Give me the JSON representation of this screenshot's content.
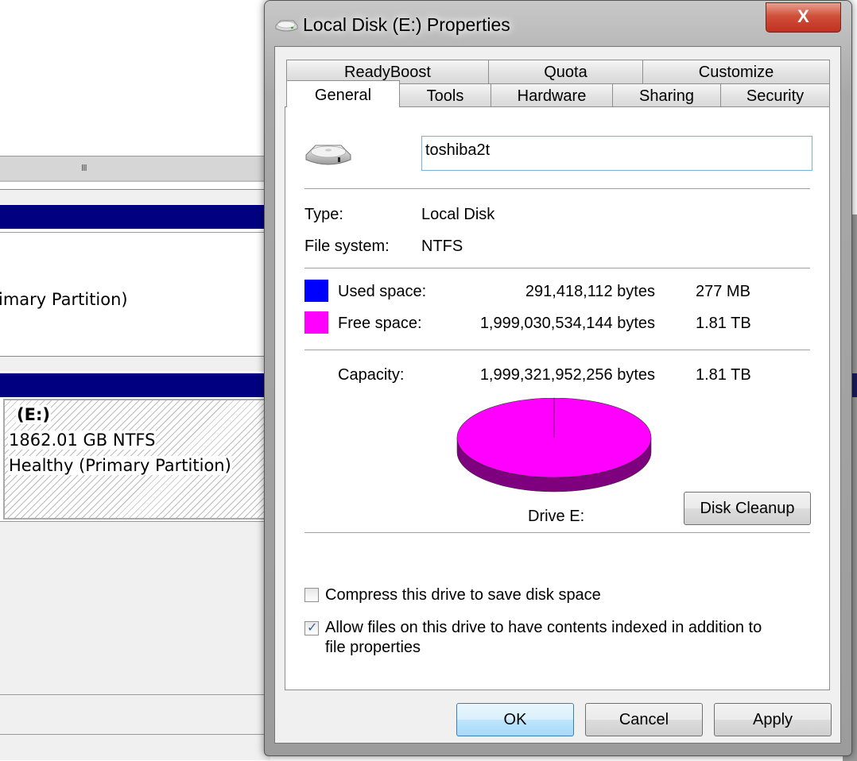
{
  "background": {
    "partition1_status_fragment": "imary Partition)",
    "partition2": {
      "drive_letter": "(E:)",
      "size_fs": "1862.01 GB NTFS",
      "status": "Healthy (Primary Partition)"
    },
    "scroll_grip": "III"
  },
  "dialog": {
    "title": "Local Disk (E:) Properties",
    "close_label": "X",
    "tabs_back_row": [
      {
        "label": "ReadyBoost"
      },
      {
        "label": "Quota"
      },
      {
        "label": "Customize"
      }
    ],
    "tabs_front_row": [
      {
        "label": "General",
        "active": true
      },
      {
        "label": "Tools"
      },
      {
        "label": "Hardware"
      },
      {
        "label": "Sharing"
      },
      {
        "label": "Security"
      }
    ],
    "general": {
      "volume_name": "toshiba2t",
      "type_label": "Type:",
      "type_value": "Local Disk",
      "fs_label": "File system:",
      "fs_value": "NTFS",
      "used": {
        "label": "Used space:",
        "bytes": "291,418,112 bytes",
        "size": "277 MB",
        "color": "#0000ff"
      },
      "free": {
        "label": "Free space:",
        "bytes": "1,999,030,534,144 bytes",
        "size": "1.81 TB",
        "color": "#ff00ff"
      },
      "capacity": {
        "label": "Capacity:",
        "bytes": "1,999,321,952,256 bytes",
        "size": "1.81 TB"
      },
      "drive_label": "Drive E:",
      "disk_cleanup_label": "Disk Cleanup",
      "compress": {
        "label": "Compress this drive to save disk space",
        "checked": false
      },
      "index": {
        "label_line1": "Allow files on this drive to have contents indexed in addition to",
        "label_line2": "file properties",
        "checked": true
      },
      "check_mark": "✓"
    },
    "buttons": {
      "ok": "OK",
      "cancel": "Cancel",
      "apply": "Apply"
    }
  },
  "chart_data": {
    "type": "pie",
    "title": "Drive E:",
    "categories": [
      "Used space",
      "Free space"
    ],
    "values": [
      291418112,
      1999030534144
    ],
    "colors": [
      "#0000ff",
      "#ff00ff"
    ]
  }
}
